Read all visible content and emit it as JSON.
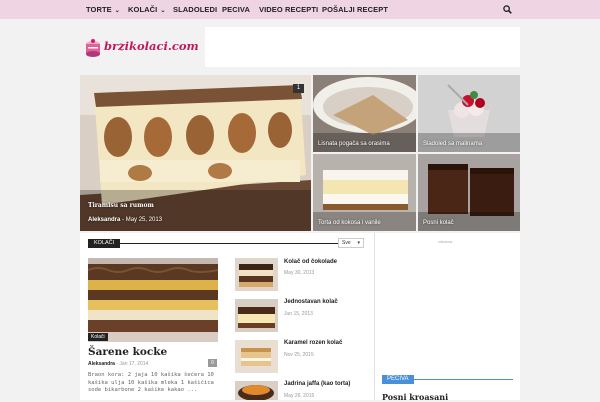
{
  "nav": {
    "items": [
      {
        "label": "TORTE",
        "dropdown": true
      },
      {
        "label": "KOLAČI",
        "dropdown": true
      },
      {
        "label": "SLADOLEDI",
        "dropdown": false
      },
      {
        "label": "PECIVA",
        "dropdown": false
      },
      {
        "label": "VIDEO RECEPTI",
        "dropdown": false
      },
      {
        "label": "POŠALJI RECEPT",
        "dropdown": false
      }
    ],
    "chevron": "⌄",
    "search_icon": "search-icon"
  },
  "logo": {
    "text": "brzikolaci.com"
  },
  "featured": {
    "main": {
      "title": "Tiramisu sa rumom",
      "author": "Aleksandra",
      "date": "May 25, 2013",
      "counter": "1"
    },
    "tiles": [
      {
        "title": "Lisnata pogača sa orasima"
      },
      {
        "title": "Sladoled sa malinama"
      },
      {
        "title": "Torta od kokosa i vanile"
      },
      {
        "title": "Posni kolač"
      }
    ]
  },
  "section": {
    "label": "KOLAČI",
    "filter": "Sve",
    "big": {
      "category": "Kolači",
      "title": "Šarene kocke",
      "author": "Aleksandra",
      "date": "Jan 17, 2014",
      "comments": "0",
      "excerpt": "Braon kora: 2 jaja 10 kašika šećera 10 kašika ulja 10 kašika mleka 1 kašičica sode bikarbone 2 kašike kakao ..."
    },
    "list": [
      {
        "title": "Kolač od čokolade",
        "date": "May 30, 2013"
      },
      {
        "title": "Jednostavan kolač",
        "date": "Jun 15, 2013"
      },
      {
        "title": "Karamel rozen kolač",
        "date": "Nov 25, 2015"
      },
      {
        "title": "Jadrina jaffa (kao torta)",
        "date": "May 26, 2015"
      }
    ]
  },
  "sidebar": {
    "ad_label": "reklama",
    "tag": "PECIVA",
    "post_title": "Posni kroasani"
  }
}
